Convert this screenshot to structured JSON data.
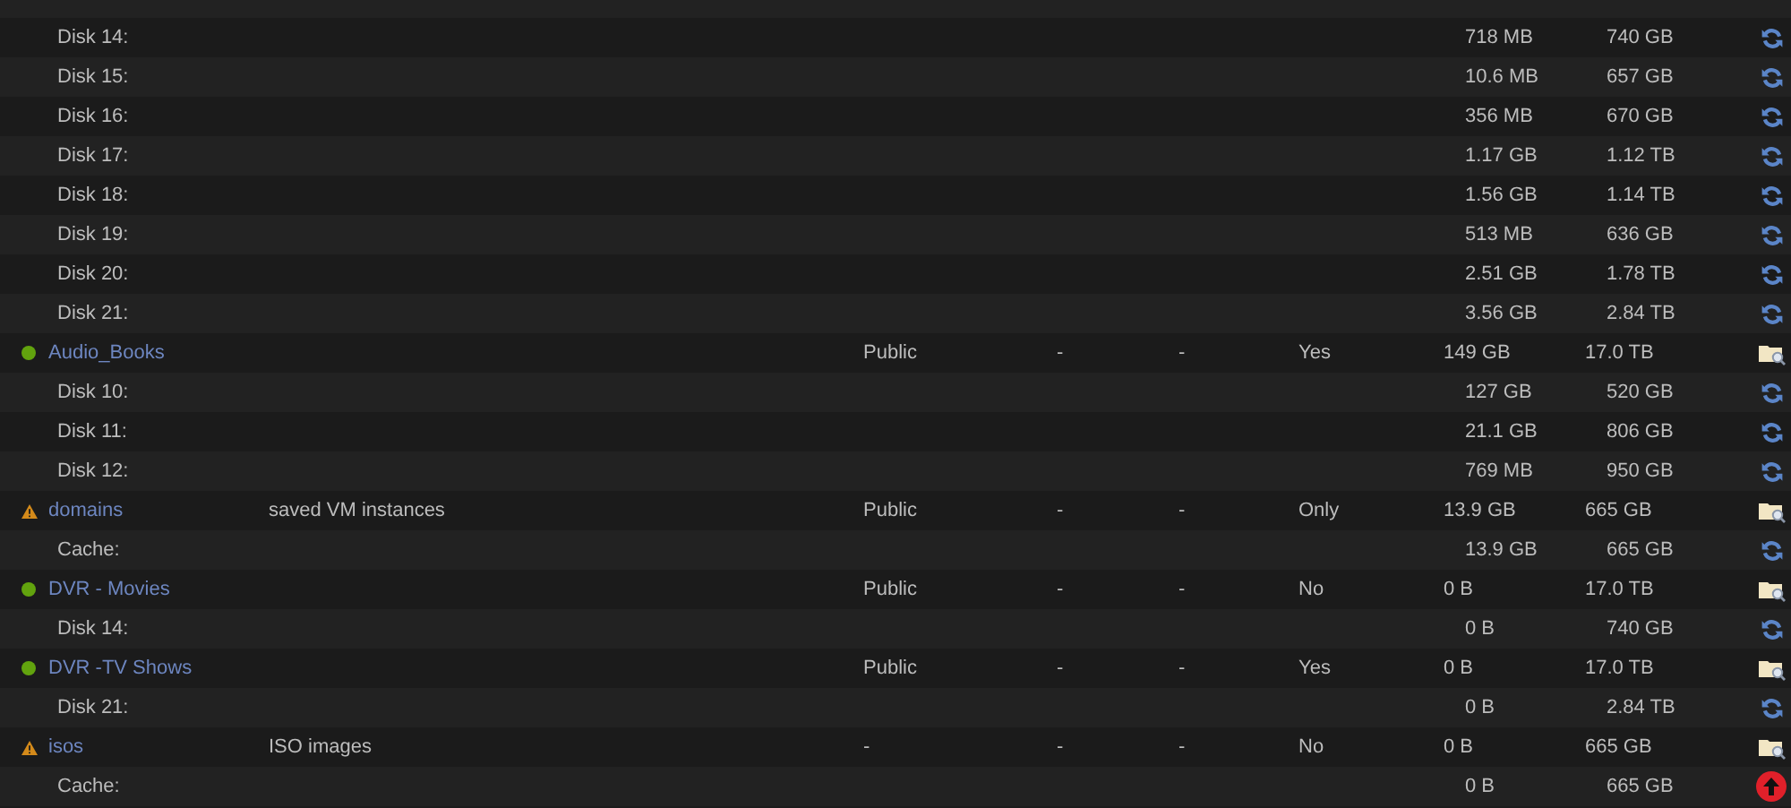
{
  "rows": [
    {
      "kind": "disk",
      "name": "Disk 14:",
      "used": "718 MB",
      "free": "740 GB"
    },
    {
      "kind": "disk",
      "name": "Disk 15:",
      "used": "10.6 MB",
      "free": "657 GB"
    },
    {
      "kind": "disk",
      "name": "Disk 16:",
      "used": "356 MB",
      "free": "670 GB"
    },
    {
      "kind": "disk",
      "name": "Disk 17:",
      "used": "1.17 GB",
      "free": "1.12 TB"
    },
    {
      "kind": "disk",
      "name": "Disk 18:",
      "used": "1.56 GB",
      "free": "1.14 TB"
    },
    {
      "kind": "disk",
      "name": "Disk 19:",
      "used": "513 MB",
      "free": "636 GB"
    },
    {
      "kind": "disk",
      "name": "Disk 20:",
      "used": "2.51 GB",
      "free": "1.78 TB"
    },
    {
      "kind": "disk",
      "name": "Disk 21:",
      "used": "3.56 GB",
      "free": "2.84 TB"
    },
    {
      "kind": "share",
      "status": {
        "kind": "dot",
        "color": "#62a30e"
      },
      "name": "Audio_Books",
      "security": "Public",
      "column_5": "-",
      "column_6": "-",
      "cache": "Yes",
      "used": "149 GB",
      "free": "17.0 TB"
    },
    {
      "kind": "disk",
      "name": "Disk 10:",
      "used": "127 GB",
      "free": "520 GB"
    },
    {
      "kind": "disk",
      "name": "Disk 11:",
      "used": "21.1 GB",
      "free": "806 GB"
    },
    {
      "kind": "disk",
      "name": "Disk 12:",
      "used": "769 MB",
      "free": "950 GB"
    },
    {
      "kind": "share",
      "status": {
        "kind": "warning",
        "color": "#d48a1a"
      },
      "name": "domains",
      "comment": "saved VM instances",
      "security": "Public",
      "column_5": "-",
      "column_6": "-",
      "cache": "Only",
      "used": "13.9 GB",
      "free": "665 GB"
    },
    {
      "kind": "disk",
      "name": "Cache:",
      "used": "13.9 GB",
      "free": "665 GB"
    },
    {
      "kind": "share",
      "status": {
        "kind": "dot",
        "color": "#62a30e"
      },
      "name": "DVR - Movies",
      "security": "Public",
      "column_5": "-",
      "column_6": "-",
      "cache": "No",
      "used": "0 B",
      "free": "17.0 TB"
    },
    {
      "kind": "disk",
      "name": "Disk 14:",
      "used": "0 B",
      "free": "740 GB"
    },
    {
      "kind": "share",
      "status": {
        "kind": "dot",
        "color": "#62a30e"
      },
      "name": "DVR -TV Shows",
      "security": "Public",
      "column_5": "-",
      "column_6": "-",
      "cache": "Yes",
      "used": "0 B",
      "free": "17.0 TB"
    },
    {
      "kind": "disk",
      "name": "Disk 21:",
      "used": "0 B",
      "free": "2.84 TB"
    },
    {
      "kind": "share",
      "status": {
        "kind": "warning",
        "color": "#d48a1a"
      },
      "name": "isos",
      "comment": "ISO images",
      "security": "-",
      "column_5": "-",
      "column_6": "-",
      "cache": "No",
      "used": "0 B",
      "free": "665 GB"
    },
    {
      "kind": "disk_alert",
      "name": "Cache:",
      "used": "0 B",
      "free": "665 GB"
    }
  ]
}
